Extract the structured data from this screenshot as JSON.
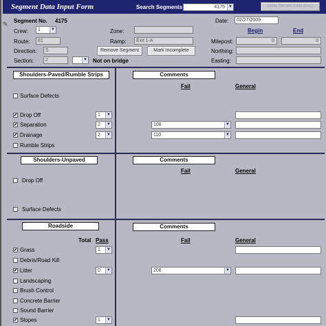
{
  "title": "Segment Data Input Form",
  "search": {
    "label": "Search Segments",
    "value": "4175"
  },
  "undo_button": "Undo Record Edits (Esc)",
  "segment_no": {
    "label": "Segment No.",
    "value": "4175"
  },
  "date": {
    "label": "Date:",
    "value": "02/27/2009"
  },
  "crew": {
    "label": "Crew:",
    "value": "1"
  },
  "zone": {
    "label": "Zone:",
    "value": ""
  },
  "begin_label": "Begin",
  "end_label": "End",
  "route": {
    "label": "Route:",
    "value": "81"
  },
  "ramp": {
    "label": "Ramp:",
    "value": "Exit 1-A"
  },
  "milepost": {
    "label": "Milepost:",
    "begin": "0",
    "end": "0"
  },
  "direction": {
    "label": "Direction:",
    "value": "S"
  },
  "remove_segment": "Remove Segment",
  "mark_incomplete": "Mark Incomplete",
  "northing": {
    "label": "Northing:"
  },
  "section": {
    "label": "Section:",
    "value": "2",
    "note": "Not on bridge"
  },
  "easting": {
    "label": "Easting:"
  },
  "sections": {
    "paved": {
      "title": "Shoulders-Paved/Rumble Strips",
      "comments": "Comments",
      "fail": "Fail",
      "general": "General",
      "items": [
        {
          "label": "Surface Defects",
          "checked": false,
          "mark": ""
        },
        {
          "label": "Drop Off",
          "checked": true,
          "mark": "✔",
          "count": "1"
        },
        {
          "label": "Separation",
          "checked": true,
          "mark": "✔",
          "count": "2",
          "fail": "108"
        },
        {
          "label": "Drainage",
          "checked": true,
          "mark": "✔",
          "count": "2",
          "fail": "110"
        },
        {
          "label": "Rumble Strips",
          "checked": false,
          "mark": ""
        }
      ]
    },
    "unpaved": {
      "title": "Shoulders-Unpaved",
      "comments": "Comments",
      "fail": "Fail",
      "general": "General",
      "items": [
        {
          "label": "Drop Off",
          "checked": false,
          "mark": ""
        },
        {
          "label": "Surface Defects",
          "checked": false,
          "mark": ""
        }
      ]
    },
    "roadside": {
      "title": "Roadside",
      "total": "Total",
      "pass": "Pass",
      "comments": "Comments",
      "fail": "Fail",
      "general": "General",
      "items": [
        {
          "label": "Grass",
          "checked": true,
          "mark": "✔",
          "count": "1"
        },
        {
          "label": "Debris/Road Kill",
          "checked": false,
          "mark": ""
        },
        {
          "label": "Litter",
          "checked": true,
          "mark": "✔",
          "count": "0",
          "fail": "206"
        },
        {
          "label": "Landscaping",
          "checked": false,
          "mark": ""
        },
        {
          "label": "Brush Control",
          "checked": false,
          "mark": ""
        },
        {
          "label": "Concrete Barrier",
          "checked": false,
          "mark": ""
        },
        {
          "label": "Sound Barrier",
          "checked": false,
          "mark": ""
        },
        {
          "label": "Slopes",
          "checked": true,
          "mark": "✔",
          "count": "1"
        }
      ]
    }
  }
}
